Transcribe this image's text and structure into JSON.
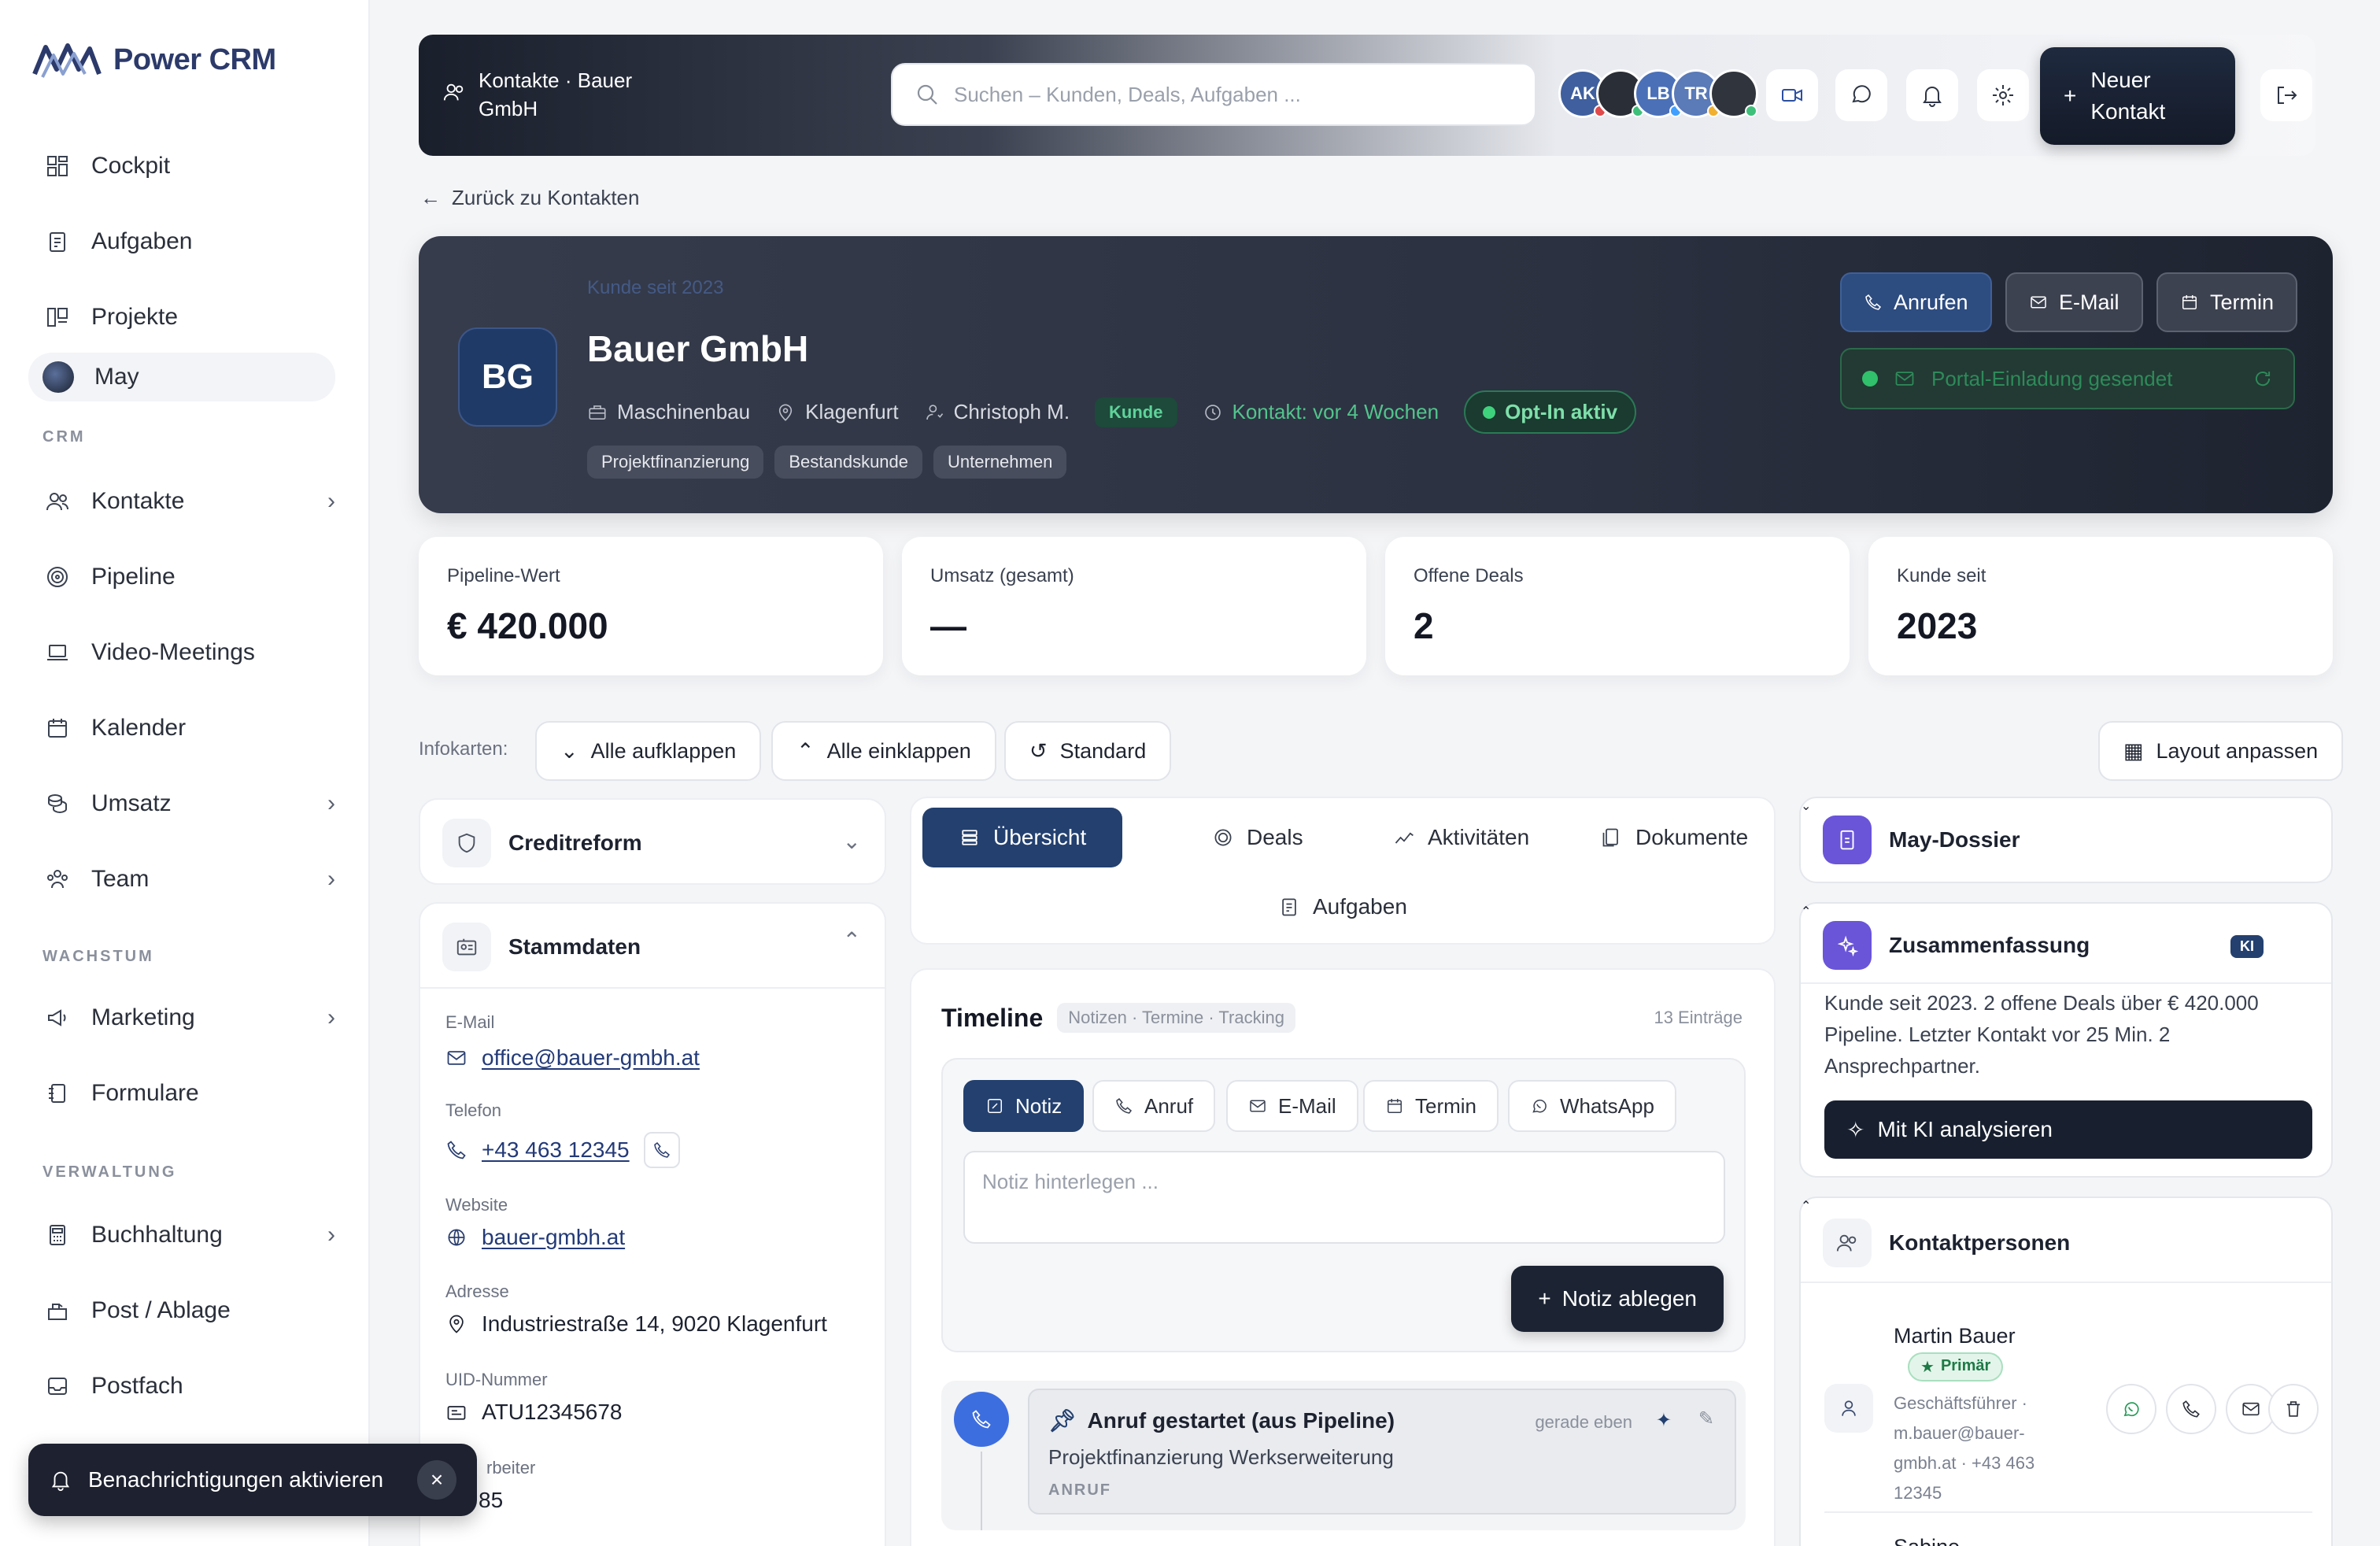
{
  "app": {
    "logo_text": "Power CRM"
  },
  "sidebar": {
    "items_top": [
      {
        "label": "Cockpit",
        "icon": "dashboard-icon"
      },
      {
        "label": "Aufgaben",
        "icon": "clipboard-icon"
      },
      {
        "label": "Projekte",
        "icon": "kanban-icon"
      },
      {
        "label": "May",
        "icon": "may-avatar"
      }
    ],
    "section_crm": "CRM",
    "items_crm": [
      {
        "label": "Kontakte",
        "icon": "users-icon",
        "chevron": "›"
      },
      {
        "label": "Pipeline",
        "icon": "target-icon",
        "chevron": ""
      },
      {
        "label": "Video-Meetings",
        "icon": "laptop-icon",
        "chevron": ""
      },
      {
        "label": "Kalender",
        "icon": "calendar-icon",
        "chevron": ""
      },
      {
        "label": "Umsatz",
        "icon": "coins-icon",
        "chevron": "›"
      },
      {
        "label": "Team",
        "icon": "team-icon",
        "chevron": "›"
      }
    ],
    "section_wachstum": "WACHSTUM",
    "items_wachstum": [
      {
        "label": "Marketing",
        "icon": "megaphone-icon",
        "chevron": "›"
      },
      {
        "label": "Formulare",
        "icon": "form-icon",
        "chevron": ""
      }
    ],
    "section_verwaltung": "VERWALTUNG",
    "items_verwaltung": [
      {
        "label": "Buchhaltung",
        "icon": "calculator-icon",
        "chevron": "›"
      },
      {
        "label": "Post / Ablage",
        "icon": "mailbox-icon",
        "chevron": ""
      },
      {
        "label": "Postfach",
        "icon": "inbox-icon",
        "chevron": ""
      }
    ],
    "toast": {
      "label": "Benachrichtigungen aktivieren",
      "close": "×"
    }
  },
  "topbar": {
    "breadcrumb_line1": "Kontakte · Bauer",
    "breadcrumb_line2": "GmbH",
    "search_placeholder": "Suchen – Kunden, Deals, Aufgaben ...",
    "avatars": [
      {
        "initials": "AK",
        "color": "#3f5f9e",
        "status": "#e04a4a"
      },
      {
        "initials": "",
        "color": "#2a2e36",
        "status": "#3fc07a"
      },
      {
        "initials": "LB",
        "color": "#4b70b8",
        "status": "#3fa0ff"
      },
      {
        "initials": "TR",
        "color": "#5a7ab8",
        "status": "#f0b030"
      },
      {
        "initials": "",
        "color": "#30343c",
        "status": "#3fc07a"
      }
    ],
    "new_contact_line1": "Neuer",
    "new_contact_line2": "Kontakt",
    "new_contact_plus": "+"
  },
  "back_link": "Zurück zu Kontakten",
  "hero": {
    "initials": "BG",
    "faded_label": "Kunde seit 2023",
    "title": "Bauer GmbH",
    "industry": "Maschinenbau",
    "city": "Klagenfurt",
    "owner": "Christoph M.",
    "status_pill": "Kunde",
    "last_contact": "Kontakt: vor 4 Wochen",
    "optin": "Opt-In aktiv",
    "tags": [
      "Projektfinanzierung",
      "Bestandskunde",
      "Unternehmen"
    ],
    "btn_call": "Anrufen",
    "btn_email": "E-Mail",
    "btn_meeting": "Termin",
    "portal_label": "Portal-Einladung gesendet"
  },
  "kpis": [
    {
      "label": "Pipeline-Wert",
      "value": "€ 420.000"
    },
    {
      "label": "Umsatz (gesamt)",
      "value": "—"
    },
    {
      "label": "Offene Deals",
      "value": "2"
    },
    {
      "label": "Kunde seit",
      "value": "2023"
    }
  ],
  "infokarten": {
    "label": "Infokarten:",
    "expand_all": "Alle aufklappen",
    "collapse_all": "Alle einklappen",
    "standard": "Standard",
    "layout": "Layout anpassen"
  },
  "creditreform": {
    "title": "Creditreform"
  },
  "stammdaten": {
    "title": "Stammdaten",
    "email_label": "E-Mail",
    "email": "office@bauer-gmbh.at",
    "phone_label": "Telefon",
    "phone": "+43 463 12345",
    "website_label": "Website",
    "website": "bauer-gmbh.at",
    "address_label": "Adresse",
    "address": "Industriestraße 14, 9020 Klagenfurt",
    "uid_label": "UID-Nummer",
    "uid": "ATU12345678",
    "employees_label": "rbeiter",
    "employees": "85"
  },
  "tabs": {
    "overview": "Übersicht",
    "deals": "Deals",
    "activities": "Aktivitäten",
    "documents": "Dokumente",
    "tasks": "Aufgaben"
  },
  "timeline": {
    "title": "Timeline",
    "subtitle": "Notizen · Termine · Tracking",
    "count": "13 Einträge",
    "composer_tabs": [
      "Notiz",
      "Anruf",
      "E-Mail",
      "Termin",
      "WhatsApp"
    ],
    "note_placeholder": "Notiz hinterlegen ...",
    "note_button": "Notiz ablegen",
    "entry_title": "Anruf gestartet (aus Pipeline)",
    "entry_time": "gerade eben",
    "entry_text": "Projektfinanzierung Werkserweiterung",
    "entry_type": "ANRUF"
  },
  "dossier": {
    "title": "May-Dossier"
  },
  "summary": {
    "title": "Zusammenfassung",
    "badge": "KI",
    "text": "Kunde seit 2023. 2 offene Deals über € 420.000 Pipeline. Letzter Kontakt vor 25 Min. 2 Ansprechpartner.",
    "button": "Mit KI analysieren"
  },
  "contacts": {
    "title": "Kontaktpersonen",
    "person_name": "Martin Bauer",
    "person_badge": "Primär",
    "person_details": "Geschäftsführer · m.bauer@bauer-gmbh.at · +43 463 12345",
    "next_person": "Sabine"
  }
}
